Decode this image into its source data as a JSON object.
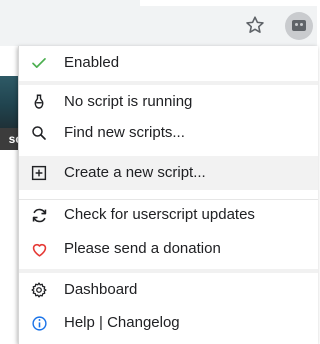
{
  "toolbar": {
    "star_icon": "star-outline-icon",
    "extension_icon": "tampermonkey-icon"
  },
  "page": {
    "visible_fragment": "sc"
  },
  "menu": {
    "items": [
      {
        "label": "Enabled",
        "icon": "check-icon",
        "color": "#4caf50"
      },
      {
        "label": "No script is running",
        "icon": "script-icon",
        "color": "#202124"
      },
      {
        "label": "Find new scripts...",
        "icon": "search-icon",
        "color": "#202124"
      },
      {
        "label": "Create a new script...",
        "icon": "plus-square-icon",
        "color": "#202124",
        "highlighted": true
      },
      {
        "label": "Check for userscript updates",
        "icon": "refresh-icon",
        "color": "#202124"
      },
      {
        "label": "Please send a donation",
        "icon": "heart-icon",
        "color": "#e53935"
      },
      {
        "label": "Dashboard",
        "icon": "gear-icon",
        "color": "#202124"
      },
      {
        "label": "Help | Changelog",
        "icon": "info-icon",
        "color": "#1a73e8"
      }
    ]
  }
}
